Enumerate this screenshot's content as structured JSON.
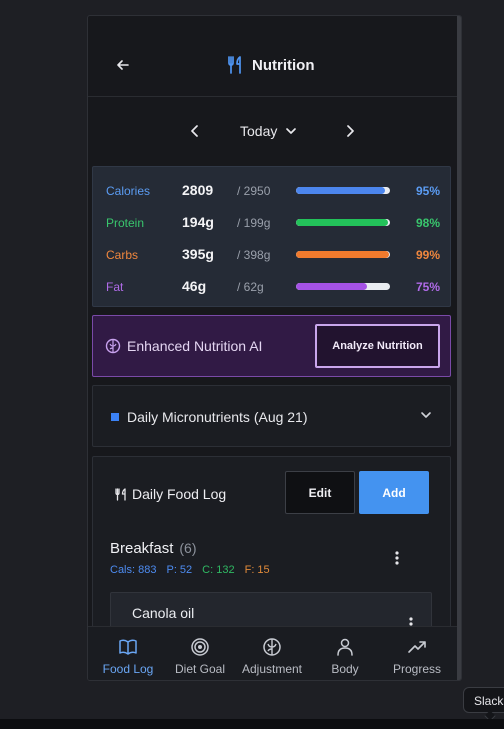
{
  "header": {
    "title": "Nutrition",
    "icon": "fork-knife-icon"
  },
  "date": {
    "label": "Today"
  },
  "macros": [
    {
      "name": "Calories",
      "value": "2809",
      "goal": "/ 2950",
      "percent": "95%",
      "fraction": 0.95,
      "color": "#5b9cf3",
      "bar": "#4c86ee"
    },
    {
      "name": "Protein",
      "value": "194g",
      "goal": "/ 199g",
      "percent": "98%",
      "fraction": 0.98,
      "color": "#39c66d",
      "bar": "#23c25a"
    },
    {
      "name": "Carbs",
      "value": "395g",
      "goal": "/ 398g",
      "percent": "99%",
      "fraction": 0.99,
      "color": "#f0873e",
      "bar": "#f07a2d"
    },
    {
      "name": "Fat",
      "value": "46g",
      "goal": "/ 62g",
      "percent": "75%",
      "fraction": 0.75,
      "color": "#b06be8",
      "bar": "#a552e6"
    }
  ],
  "ai": {
    "label": "Enhanced Nutrition AI",
    "button": "Analyze Nutrition"
  },
  "micronutrients": {
    "label": "Daily Micronutrients (Aug 21)"
  },
  "food_log": {
    "title": "Daily Food Log",
    "edit_label": "Edit",
    "add_label": "Add",
    "meal": {
      "name": "Breakfast",
      "count": "(6)",
      "stats": [
        {
          "text": "Cals: 883",
          "color": "#4d8bf0"
        },
        {
          "text": "P: 52",
          "color": "#4d8bf0"
        },
        {
          "text": "C: 132",
          "color": "#2fb862"
        },
        {
          "text": "F: 15",
          "color": "#e08a3a"
        }
      ],
      "first_item": "Canola oil"
    }
  },
  "tabs": [
    {
      "label": "Food Log",
      "icon": "book-icon",
      "active": true
    },
    {
      "label": "Diet Goal",
      "icon": "target-icon",
      "active": false
    },
    {
      "label": "Adjustment",
      "icon": "brain-icon",
      "active": false
    },
    {
      "label": "Body",
      "icon": "person-icon",
      "active": false
    },
    {
      "label": "Progress",
      "icon": "trend-up-icon",
      "active": false
    }
  ],
  "tooltip": {
    "text": "Slack"
  }
}
